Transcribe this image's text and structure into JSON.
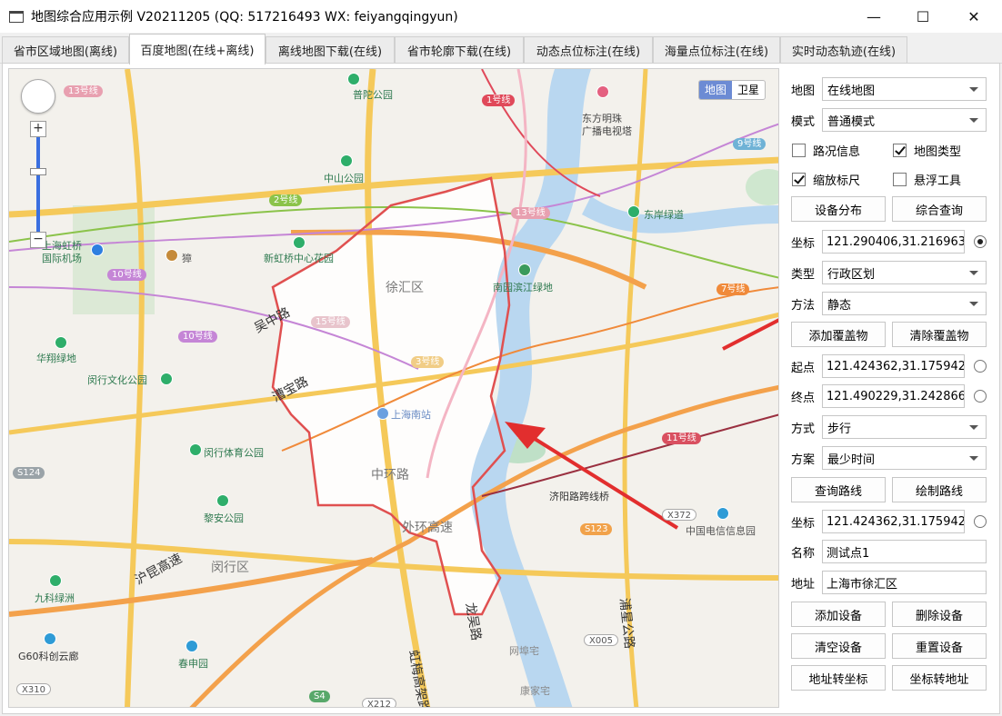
{
  "window": {
    "title": "地图综合应用示例 V20211205 (QQ: 517216493 WX: feiyangqingyun)",
    "minimize": "—",
    "maximize": "☐",
    "close": "✕"
  },
  "tabs": [
    {
      "label": "省市区域地图(离线)",
      "active": false
    },
    {
      "label": "百度地图(在线+离线)",
      "active": true
    },
    {
      "label": "离线地图下载(在线)",
      "active": false
    },
    {
      "label": "省市轮廓下载(在线)",
      "active": false
    },
    {
      "label": "动态点位标注(在线)",
      "active": false
    },
    {
      "label": "海量点位标注(在线)",
      "active": false
    },
    {
      "label": "实时动态轨迹(在线)",
      "active": false
    }
  ],
  "map": {
    "type_toggle": {
      "map": "地图",
      "satellite": "卫星"
    },
    "zoom_in": "+",
    "zoom_out": "−",
    "labels": {
      "putuo_park": "普陀公园",
      "oriental_pearl": "东方明珠\n广播电视塔",
      "zhongshan_park": "中山公园",
      "dongan_greenway": "东岸绿道",
      "hongqiao_airport": "上海虹桥\n国际机场",
      "xinhongqiao_park": "新虹桥中心花园",
      "xuhui": "徐汇区",
      "nanpu_greenland": "南园滨江绿地",
      "wuzhong_road": "吴中路",
      "huaxiang_green": "华翔绿地",
      "minhang_culture_park": "闵行文化公园",
      "caobao_road": "漕宝路",
      "shanghai_south": "上海南站",
      "minhang_sports_park": "闵行体育公园",
      "middle_ring": "中环路",
      "outer_ring": "外环高速",
      "jiyang_bridge": "济阳路跨线桥",
      "china_telecom": "中国电信信息园",
      "lixin_park": "黎安公园",
      "hukun_highway": "沪昆高速",
      "minhang_district": "闵行区",
      "jiuke_green": "九科绿洲",
      "longwu_road": "龙吴路",
      "puxing_road": "浦星公路",
      "g60": "G60科创云廊",
      "chunshen_park": "春申园",
      "hongmei_viaduct": "虹梅高架路",
      "wangbu": "网埠宅",
      "kangjia": "康家宅",
      "town": "獐"
    },
    "metro": {
      "l13a": "13号线",
      "l1": "1号线",
      "l9": "9号线",
      "l2": "2号线",
      "l13b": "13号线",
      "l10a": "10号线",
      "l10b": "10号线",
      "l7": "7号线",
      "l15": "15号线",
      "l3": "3号线",
      "l11": "11号线"
    },
    "shields": {
      "s124": "S124",
      "x372": "X372",
      "s123": "S123",
      "x005": "X005",
      "x310": "X310",
      "x212": "X212",
      "s4": "S4"
    }
  },
  "panel": {
    "map_label": "地图",
    "map_value": "在线地图",
    "mode_label": "模式",
    "mode_value": "普通模式",
    "traffic": {
      "label": "路况信息",
      "checked": false
    },
    "maptype": {
      "label": "地图类型",
      "checked": true
    },
    "scale": {
      "label": "缩放标尺",
      "checked": true
    },
    "floattool": {
      "label": "悬浮工具",
      "checked": false
    },
    "btn_device_dist": "设备分布",
    "btn_query": "综合查询",
    "coord_label": "坐标",
    "coord_value": "121.290406,31.216963",
    "type_label": "类型",
    "type_value": "行政区划",
    "method_label": "方法",
    "method_value": "静态",
    "btn_add_overlay": "添加覆盖物",
    "btn_clear_overlay": "清除覆盖物",
    "start_label": "起点",
    "start_value": "121.424362,31.175942",
    "end_label": "终点",
    "end_value": "121.490229,31.242866",
    "way_label": "方式",
    "way_value": "步行",
    "plan_label": "方案",
    "plan_value": "最少时间",
    "btn_query_route": "查询路线",
    "btn_draw_route": "绘制路线",
    "coord2_label": "坐标",
    "coord2_value": "121.424362,31.175942",
    "name_label": "名称",
    "name_value": "测试点1",
    "addr_label": "地址",
    "addr_value": "上海市徐汇区",
    "btn_add_device": "添加设备",
    "btn_del_device": "删除设备",
    "btn_clear_device": "清空设备",
    "btn_reset_device": "重置设备",
    "btn_addr2coord": "地址转坐标",
    "btn_coord2addr": "坐标转地址"
  },
  "colors": {
    "accent": "#e03a3a",
    "boundary": "#e05050",
    "metro_red": "#e0495a"
  }
}
